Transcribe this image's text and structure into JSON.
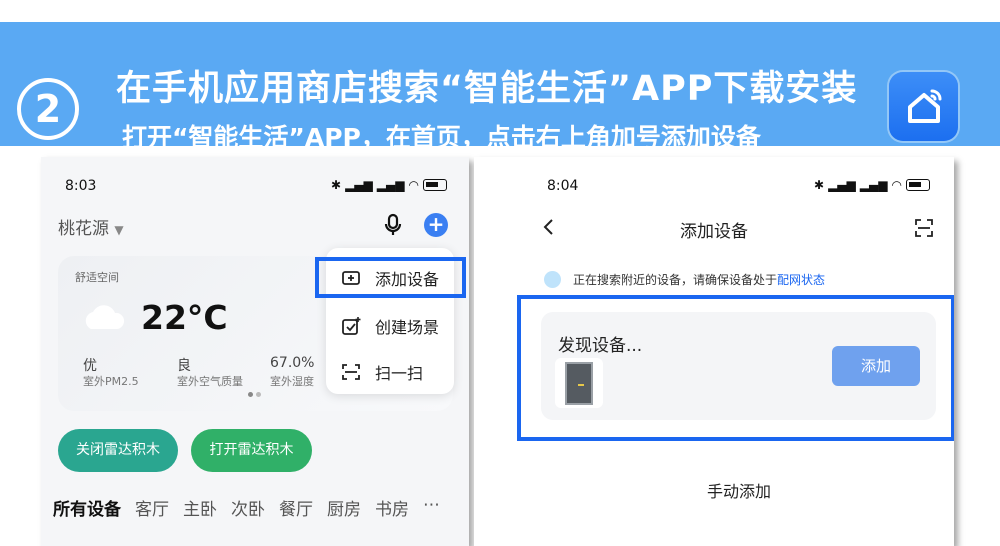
{
  "banner": {
    "step_number": "2",
    "title": "在手机应用商店搜索“智能生活”APP下载安装",
    "subtitle": "打开“智能生活”APP，在首页，点击右上角加号添加设备",
    "app_icon": "smart-home-icon",
    "color": "#5aa9f3"
  },
  "phone1": {
    "status_time": "8:03",
    "status_icons": [
      "bluetooth-icon",
      "signal-icon",
      "signal-icon",
      "wifi-icon",
      "battery-icon"
    ],
    "home_name": "桃花源",
    "weather": {
      "label": "舒适空间",
      "temperature": "22°C",
      "metrics": [
        {
          "value": "优",
          "label": "室外PM2.5"
        },
        {
          "value": "良",
          "label": "室外空气质量"
        },
        {
          "value": "67.0%",
          "label": "室外湿度"
        }
      ]
    },
    "popup_menu": [
      {
        "label": "添加设备",
        "icon": "add-device-icon"
      },
      {
        "label": "创建场景",
        "icon": "create-scene-icon"
      },
      {
        "label": "扫一扫",
        "icon": "scan-icon"
      }
    ],
    "scene_buttons": [
      "关闭雷达积木",
      "打开雷达积木"
    ],
    "tabs": [
      "所有设备",
      "客厅",
      "主卧",
      "次卧",
      "餐厅",
      "厨房",
      "书房"
    ],
    "accent_color": "#3a7ff2"
  },
  "phone2": {
    "status_time": "8:04",
    "page_title": "添加设备",
    "search_text": "正在搜索附近的设备，请确保设备处于",
    "search_link": "配网状态",
    "found_title": "发现设备...",
    "add_button": "添加",
    "manual_add": "手动添加"
  },
  "highlight_color": "#1a66f0"
}
